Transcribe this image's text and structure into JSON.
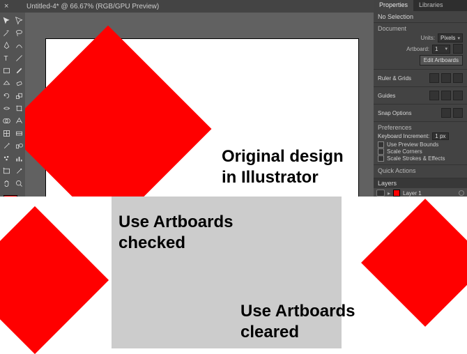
{
  "title": "Untitled-4* @ 66.67% (RGB/GPU Preview)",
  "canvas_label_l1": "Original design",
  "canvas_label_l2": "in Illustrator",
  "properties": {
    "tab1": "Properties",
    "tab2": "Libraries",
    "no_selection": "No Selection",
    "document": "Document",
    "units_lbl": "Units:",
    "units_val": "Pixels",
    "artboard_lbl": "Artboard:",
    "artboard_val": "1",
    "edit_artboards": "Edit Artboards",
    "ruler_grids": "Ruler & Grids",
    "guides": "Guides",
    "snap_options": "Snap Options",
    "preferences": "Preferences",
    "kb_inc_lbl": "Keyboard Increment:",
    "kb_inc_val": "1 px",
    "use_preview": "Use Preview Bounds",
    "scale_corners": "Scale Corners",
    "scale_strokes": "Scale Strokes & Effects",
    "quick_actions": "Quick Actions",
    "layers": "Layers",
    "layer1": "Layer 1"
  },
  "bottom_left_l1": "Use Artboards",
  "bottom_left_l2": "checked",
  "bottom_right_l1": "Use Artboards",
  "bottom_right_l2": "cleared",
  "colors": {
    "red": "#ff0000",
    "panel": "#434343"
  },
  "icons": {
    "close": "close-icon",
    "chevron": "chevron-down-icon"
  }
}
